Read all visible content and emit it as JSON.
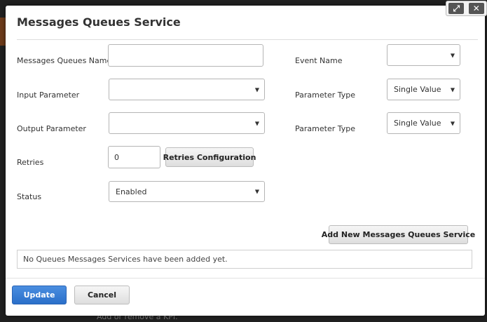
{
  "dialog": {
    "title": "Messages Queues Service"
  },
  "window_controls": {
    "expand_icon": "expand-icon",
    "close_icon": "close-icon"
  },
  "form": {
    "queue_name": {
      "label": "Messages Queues Name",
      "value": ""
    },
    "event_name": {
      "label": "Event Name",
      "value": ""
    },
    "input_parameter": {
      "label": "Input Parameter",
      "value": ""
    },
    "input_parameter_type": {
      "label": "Parameter Type",
      "value": "Single Value"
    },
    "output_parameter": {
      "label": "Output Parameter",
      "value": ""
    },
    "output_parameter_type": {
      "label": "Parameter Type",
      "value": "Single Value"
    },
    "retries": {
      "label": "Retries",
      "value": "0"
    },
    "retries_config_button": "Retries Configuration",
    "status": {
      "label": "Status",
      "value": "Enabled"
    }
  },
  "add_button": "Add New Messages Queues Service",
  "info_message": "No Queues Messages Services have been added yet.",
  "footer": {
    "update_label": "Update",
    "cancel_label": "Cancel"
  },
  "background_text": "Add or remove a KPI.",
  "colors": {
    "primary": "#2a6fc9",
    "backdrop": "#202020"
  }
}
